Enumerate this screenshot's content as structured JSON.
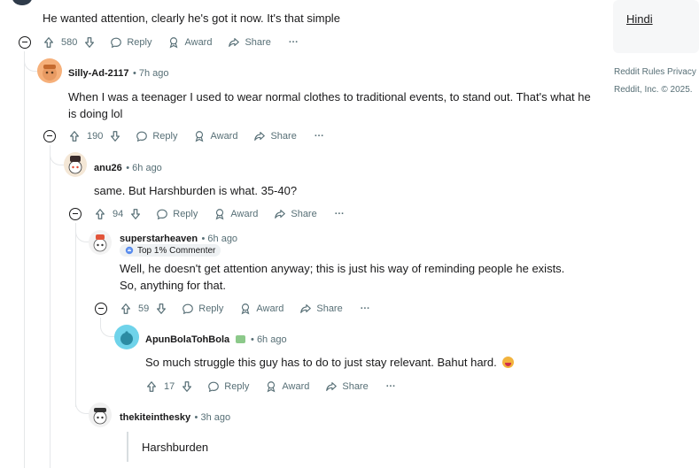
{
  "sidebar": {
    "language_link": "Hindi",
    "footer_line1": "Reddit Rules  Privacy",
    "footer_line2": "Reddit, Inc. © 2025."
  },
  "actions": {
    "reply": "Reply",
    "award": "Award",
    "share": "Share",
    "more": "···"
  },
  "comments": [
    {
      "username": "",
      "time": "",
      "text": "He wanted attention, clearly he's got it now. It's that simple",
      "votes": "580"
    },
    {
      "username": "Silly-Ad-2117",
      "time": "• 7h ago",
      "text": "When I was a teenager I used to wear normal clothes to traditional events, to stand out. That's what he is doing lol",
      "votes": "190"
    },
    {
      "username": "anu26",
      "time": "• 6h ago",
      "text": "same. But Harshburden is what. 35-40?",
      "votes": "94"
    },
    {
      "username": "superstarheaven",
      "time": "• 6h ago",
      "flair": "Top 1% Commenter",
      "text": "Well, he doesn't get attention anyway; this is just his way of reminding people he exists. So, anything for that.",
      "votes": "59"
    },
    {
      "username": "ApunBolaTohBola",
      "time": "• 6h ago",
      "text": "So much struggle this guy has to do to just stay relevant. Bahut hard.",
      "votes": "17"
    },
    {
      "username": "thekiteinthesky",
      "time": "• 3h ago",
      "text": "Harshburden"
    }
  ],
  "colors": {
    "meta": "#576f76",
    "thread_line": "#e5e7e9",
    "flair_bg": "#eef1f3"
  }
}
